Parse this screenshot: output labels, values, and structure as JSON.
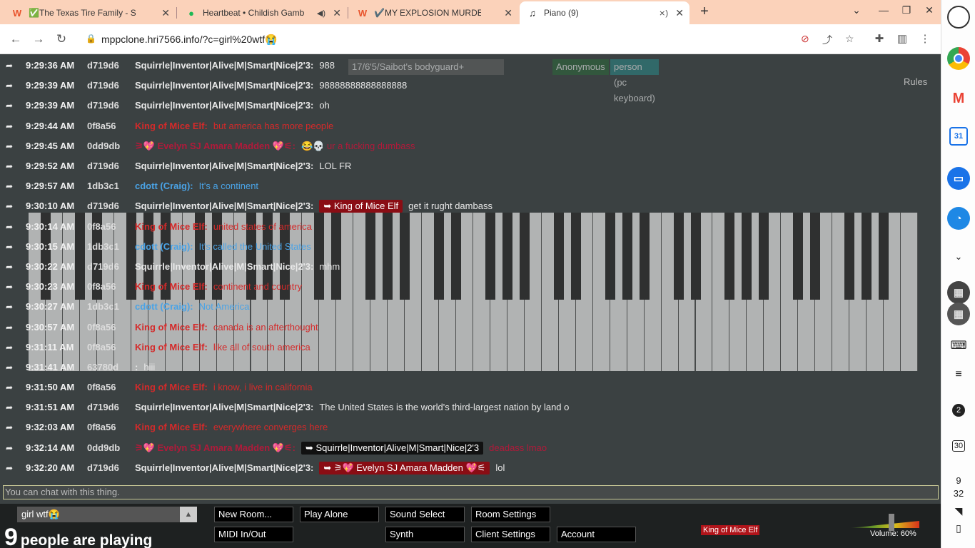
{
  "tabs": [
    {
      "icon": "tab-favicon-w",
      "title": "✅The Texas Tire Family - Shar"
    },
    {
      "icon": "tab-favicon-spotify",
      "title": "Heartbeat • Childish Gamb"
    },
    {
      "icon": "tab-favicon-w",
      "title": "✔️MY EXPLOSION MURDER AND M"
    },
    {
      "icon": "tab-favicon-piano",
      "title": "Piano (9)"
    }
  ],
  "browser": {
    "url": "mppclone.hri7566.info/?c=girl%20wtf😭"
  },
  "shelf": {
    "notif_count": "2",
    "calendar_day": "30",
    "clock_hour": "9",
    "clock_min": "32"
  },
  "top_row": {
    "badge1": "Anonymous",
    "badge2": "person (pc keyboard)",
    "badge3": "17/6'5/Saibot's bodyguard+",
    "rules": "Rules"
  },
  "chat": [
    {
      "time": "9:29:36 AM",
      "uid": "d719d6",
      "name": "Squirrle|Inventor|Alive|M|Smart|Nice|2'3:",
      "color": "#e8e8e8",
      "text": "988",
      "reply": ""
    },
    {
      "time": "9:29:39 AM",
      "uid": "d719d6",
      "name": "Squirrle|Inventor|Alive|M|Smart|Nice|2'3:",
      "color": "#e8e8e8",
      "text": "98888888888888888",
      "reply": ""
    },
    {
      "time": "9:29:39 AM",
      "uid": "d719d6",
      "name": "Squirrle|Inventor|Alive|M|Smart|Nice|2'3:",
      "color": "#e8e8e8",
      "text": "oh",
      "reply": ""
    },
    {
      "time": "9:29:44 AM",
      "uid": "0f8a56",
      "name": "King of Mice Elf:",
      "color": "#d42a2a",
      "text": "but america has more people",
      "reply": ""
    },
    {
      "time": "9:29:45 AM",
      "uid": "0dd9db",
      "name": "⚞💖 Evelyn SJ Amara Madden 💖⚟:",
      "color": "#b01a3a",
      "text": "😂💀 ur a fucking dumbass",
      "reply": ""
    },
    {
      "time": "9:29:52 AM",
      "uid": "d719d6",
      "name": "Squirrle|Inventor|Alive|M|Smart|Nice|2'3:",
      "color": "#e8e8e8",
      "text": "LOL FR",
      "reply": ""
    },
    {
      "time": "9:29:57 AM",
      "uid": "1db3c1",
      "name": "cdott (Craig):",
      "color": "#4aa3e6",
      "text": "It's a continent",
      "reply": ""
    },
    {
      "time": "9:30:10 AM",
      "uid": "d719d6",
      "name": "Squirrle|Inventor|Alive|M|Smart|Nice|2'3:",
      "color": "#e8e8e8",
      "text": "get it rught dambass",
      "reply": "➥ King of Mice Elf"
    },
    {
      "time": "9:30:14 AM",
      "uid": "0f8a56",
      "name": "King of Mice Elf:",
      "color": "#d42a2a",
      "text": "united states of america",
      "reply": ""
    },
    {
      "time": "9:30:15 AM",
      "uid": "1db3c1",
      "name": "cdott (Craig):",
      "color": "#4aa3e6",
      "text": "It's called the United States",
      "reply": ""
    },
    {
      "time": "9:30:22 AM",
      "uid": "d719d6",
      "name": "Squirrle|Inventor|Alive|M|Smart|Nice|2'3:",
      "color": "#e8e8e8",
      "text": "mhm",
      "reply": ""
    },
    {
      "time": "9:30:23 AM",
      "uid": "0f8a56",
      "name": "King of Mice Elf:",
      "color": "#d42a2a",
      "text": "continent and country",
      "reply": ""
    },
    {
      "time": "9:30:27 AM",
      "uid": "1db3c1",
      "name": "cdott (Craig):",
      "color": "#4aa3e6",
      "text": "Not America",
      "reply": ""
    },
    {
      "time": "9:30:57 AM",
      "uid": "0f8a56",
      "name": "King of Mice Elf:",
      "color": "#d42a2a",
      "text": "canada is an afterthought",
      "reply": ""
    },
    {
      "time": "9:31:11 AM",
      "uid": "0f8a56",
      "name": "King of Mice Elf:",
      "color": "#d42a2a",
      "text": "like all of south america",
      "reply": ""
    },
    {
      "time": "9:31:41 AM",
      "uid": "63780d",
      "name": ":",
      "color": "#e8e8e8",
      "text": "hiii",
      "reply": ""
    },
    {
      "time": "9:31:50 AM",
      "uid": "0f8a56",
      "name": "King of Mice Elf:",
      "color": "#d42a2a",
      "text": "i know, i live in california",
      "reply": ""
    },
    {
      "time": "9:31:51 AM",
      "uid": "d719d6",
      "name": "Squirrle|Inventor|Alive|M|Smart|Nice|2'3:",
      "color": "#e8e8e8",
      "text": "The United States is the world's third-largest nation by land o",
      "reply": ""
    },
    {
      "time": "9:32:03 AM",
      "uid": "0f8a56",
      "name": "King of Mice Elf:",
      "color": "#d42a2a",
      "text": "everywhere converges here",
      "reply": ""
    },
    {
      "time": "9:32:14 AM",
      "uid": "0dd9db",
      "name": "⚞💖 Evelyn SJ Amara Madden 💖⚟:",
      "color": "#b01a3a",
      "text": "deadass lmao",
      "reply": "➥ Squirrle|Inventor|Alive|M|Smart|Nice|2'3"
    },
    {
      "time": "9:32:20 AM",
      "uid": "d719d6",
      "name": "Squirrle|Inventor|Alive|M|Smart|Nice|2'3:",
      "color": "#e8e8e8",
      "text": "lol",
      "reply": "➥ ⚞💖 Evelyn SJ Amara Madden 💖⚟"
    }
  ],
  "chat_placeholder": "You can chat with this thing.",
  "bottom": {
    "room_name": "girl wtf😭",
    "player_count": "9",
    "players_label": "people are playing",
    "buttons": {
      "new_room": "New Room...",
      "play_alone": "Play Alone",
      "sound_select": "Sound Select",
      "room_settings": "Room Settings",
      "midi": "MIDI In/Out",
      "synth": "Synth",
      "client_settings": "Client Settings",
      "account": "Account"
    },
    "volume": "Volume: 60%",
    "volume_level": 0.6,
    "cursor_user": "King of Mice Elf"
  }
}
